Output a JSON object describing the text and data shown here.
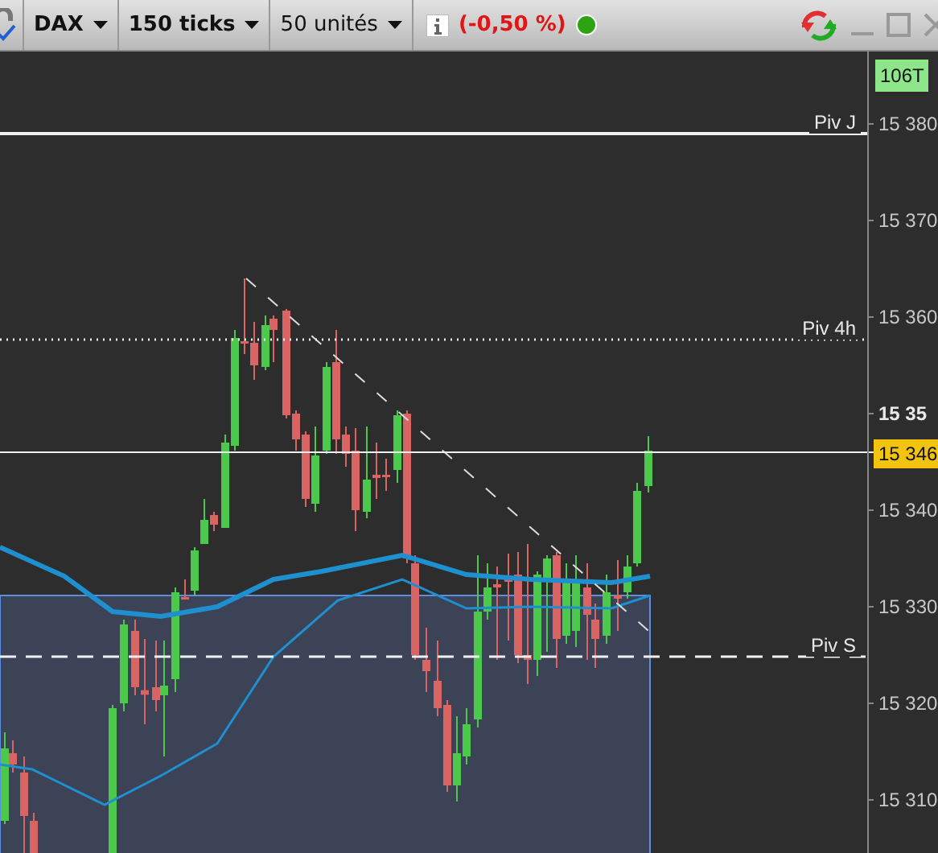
{
  "toolbar": {
    "instrument": "DAX",
    "interval": "150 ticks",
    "quantity": "50 unités",
    "change": "(-0,50 %)",
    "connected": true
  },
  "bar_count": "106T",
  "pivots": [
    {
      "label": "Piv J",
      "kind": "solid"
    },
    {
      "label": "Piv 4h",
      "kind": "dotted"
    },
    {
      "label": "Piv S",
      "kind": "dashed"
    }
  ],
  "price_axis": [
    {
      "text": "15 380",
      "emphasized": false
    },
    {
      "text": "15 370",
      "emphasized": false
    },
    {
      "text": "15 360",
      "emphasized": false
    },
    {
      "text": "15 35",
      "emphasized": true
    },
    {
      "text": "15 340",
      "emphasized": false
    },
    {
      "text": "15 330",
      "emphasized": false
    },
    {
      "text": "15 320",
      "emphasized": false
    },
    {
      "text": "15 310",
      "emphasized": false
    }
  ],
  "last_price": "15 346"
}
